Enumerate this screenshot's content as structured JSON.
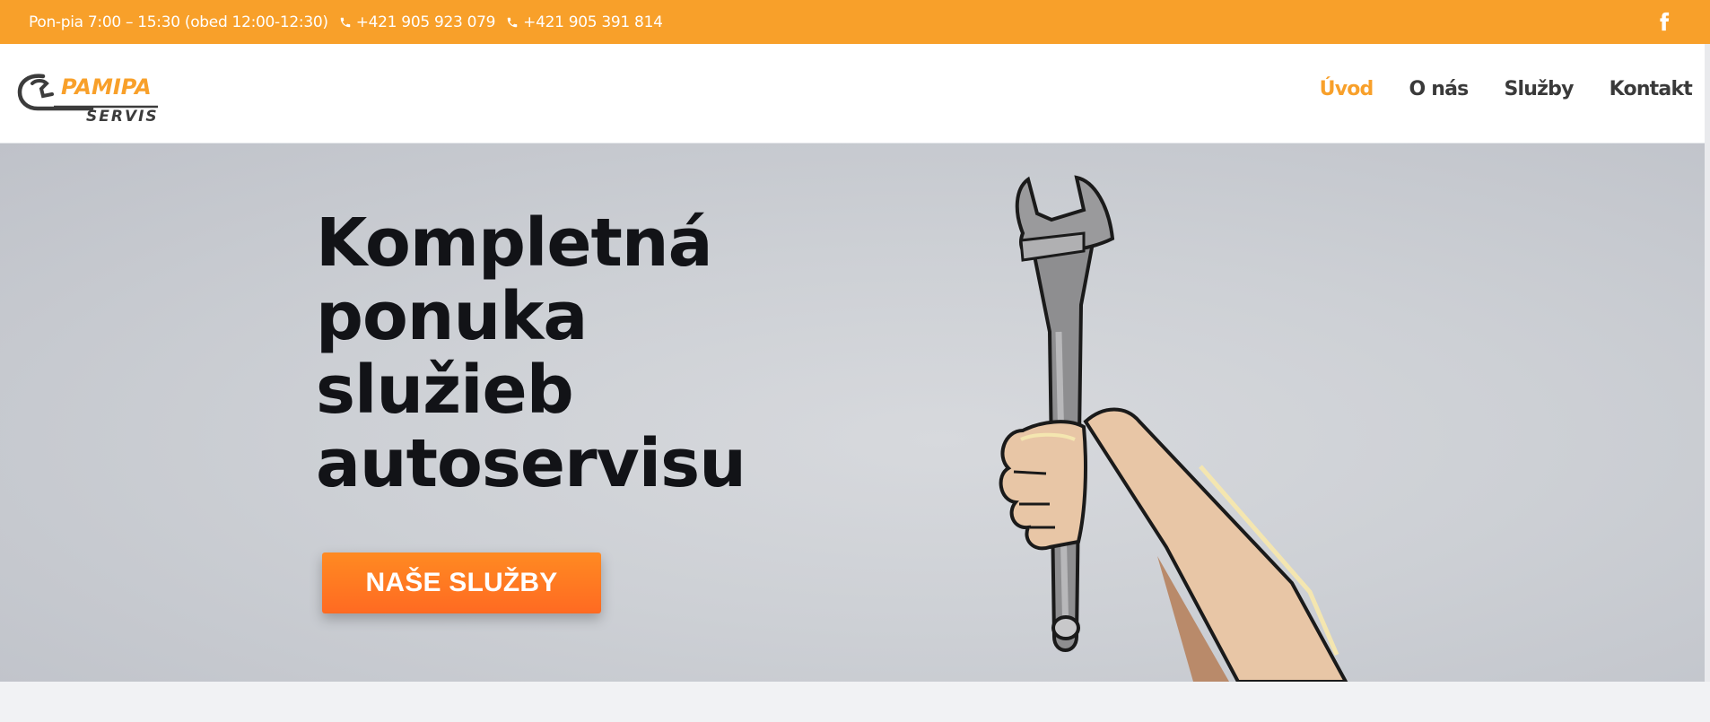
{
  "topbar": {
    "hours": "Pon-pia 7:00 – 15:30 (obed 12:00-12:30)",
    "phones": [
      "+421 905 923 079",
      "+421 905 391 814"
    ],
    "social_icon": "facebook-icon"
  },
  "logo": {
    "name": "PAMIPA",
    "sub": "SERVIS",
    "icon": "wrench-logo-icon"
  },
  "nav": {
    "items": [
      {
        "label": "Úvod",
        "active": true
      },
      {
        "label": "O nás",
        "active": false
      },
      {
        "label": "Služby",
        "active": false
      },
      {
        "label": "Kontakt",
        "active": false
      }
    ]
  },
  "hero": {
    "title_lines": [
      "Kompletná",
      "ponuka",
      "služieb",
      "autoservisu"
    ],
    "cta_label": "NAŠE SLUŽBY",
    "illustration": "hand-holding-wrench"
  },
  "colors": {
    "accent": "#f8a02a",
    "cta": "#ff7a22",
    "text_dark": "#121317",
    "nav_text": "#3a3a3a"
  }
}
